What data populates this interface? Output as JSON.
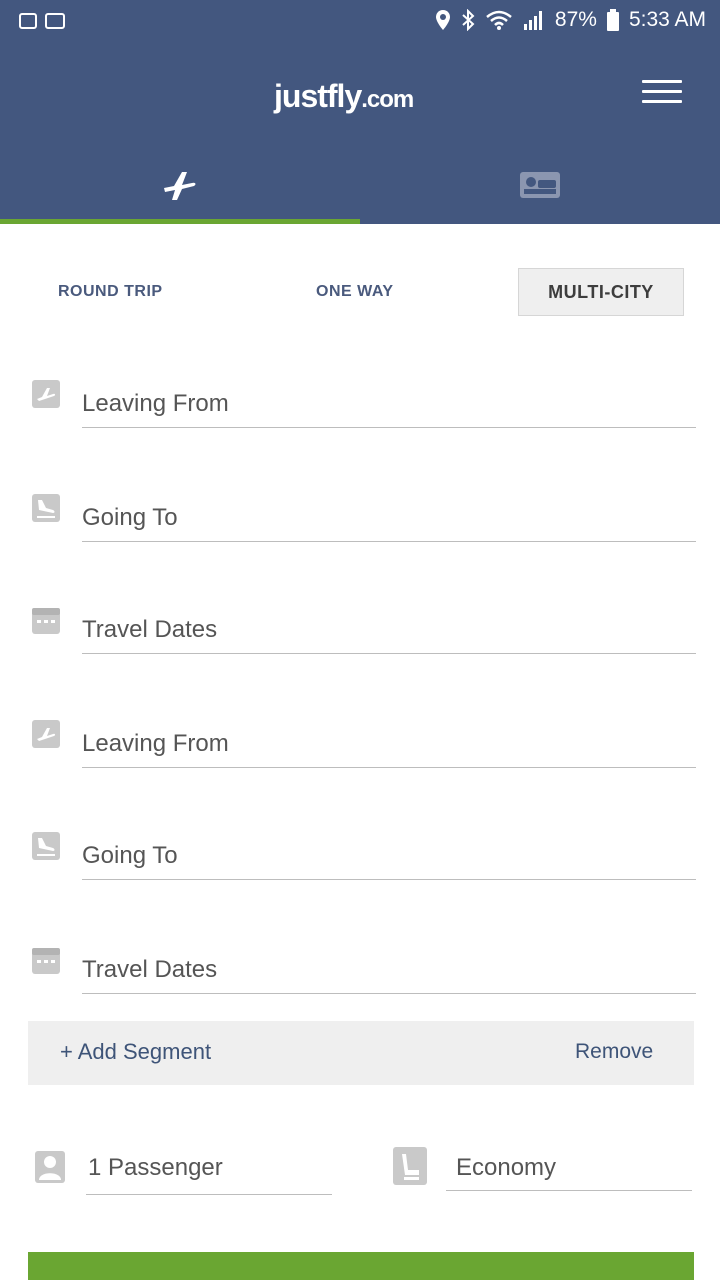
{
  "status_bar": {
    "battery": "87%",
    "time": "5:33 AM",
    "icons": [
      "location-icon",
      "bluetooth-icon",
      "wifi-icon",
      "signal-icon",
      "battery-icon"
    ]
  },
  "header": {
    "logo_main": "justfly",
    "logo_suffix": ".com",
    "tabs": [
      {
        "icon": "airplane-icon",
        "active": true
      },
      {
        "icon": "hotel-bed-icon",
        "active": false
      }
    ]
  },
  "trip_types": {
    "round_trip": "ROUND TRIP",
    "one_way": "ONE WAY",
    "multi_city": "MULTI-CITY"
  },
  "segments": [
    {
      "leaving_from": "Leaving From",
      "going_to": "Going To",
      "travel_dates": "Travel Dates"
    },
    {
      "leaving_from": "Leaving From",
      "going_to": "Going To",
      "travel_dates": "Travel Dates"
    }
  ],
  "segment_actions": {
    "add": "+ Add Segment",
    "remove": "Remove"
  },
  "passengers": "1 Passenger",
  "cabin_class": "Economy",
  "colors": {
    "header_bg": "#43577f",
    "accent_green": "#6aa632",
    "link_blue": "#3e5478"
  }
}
